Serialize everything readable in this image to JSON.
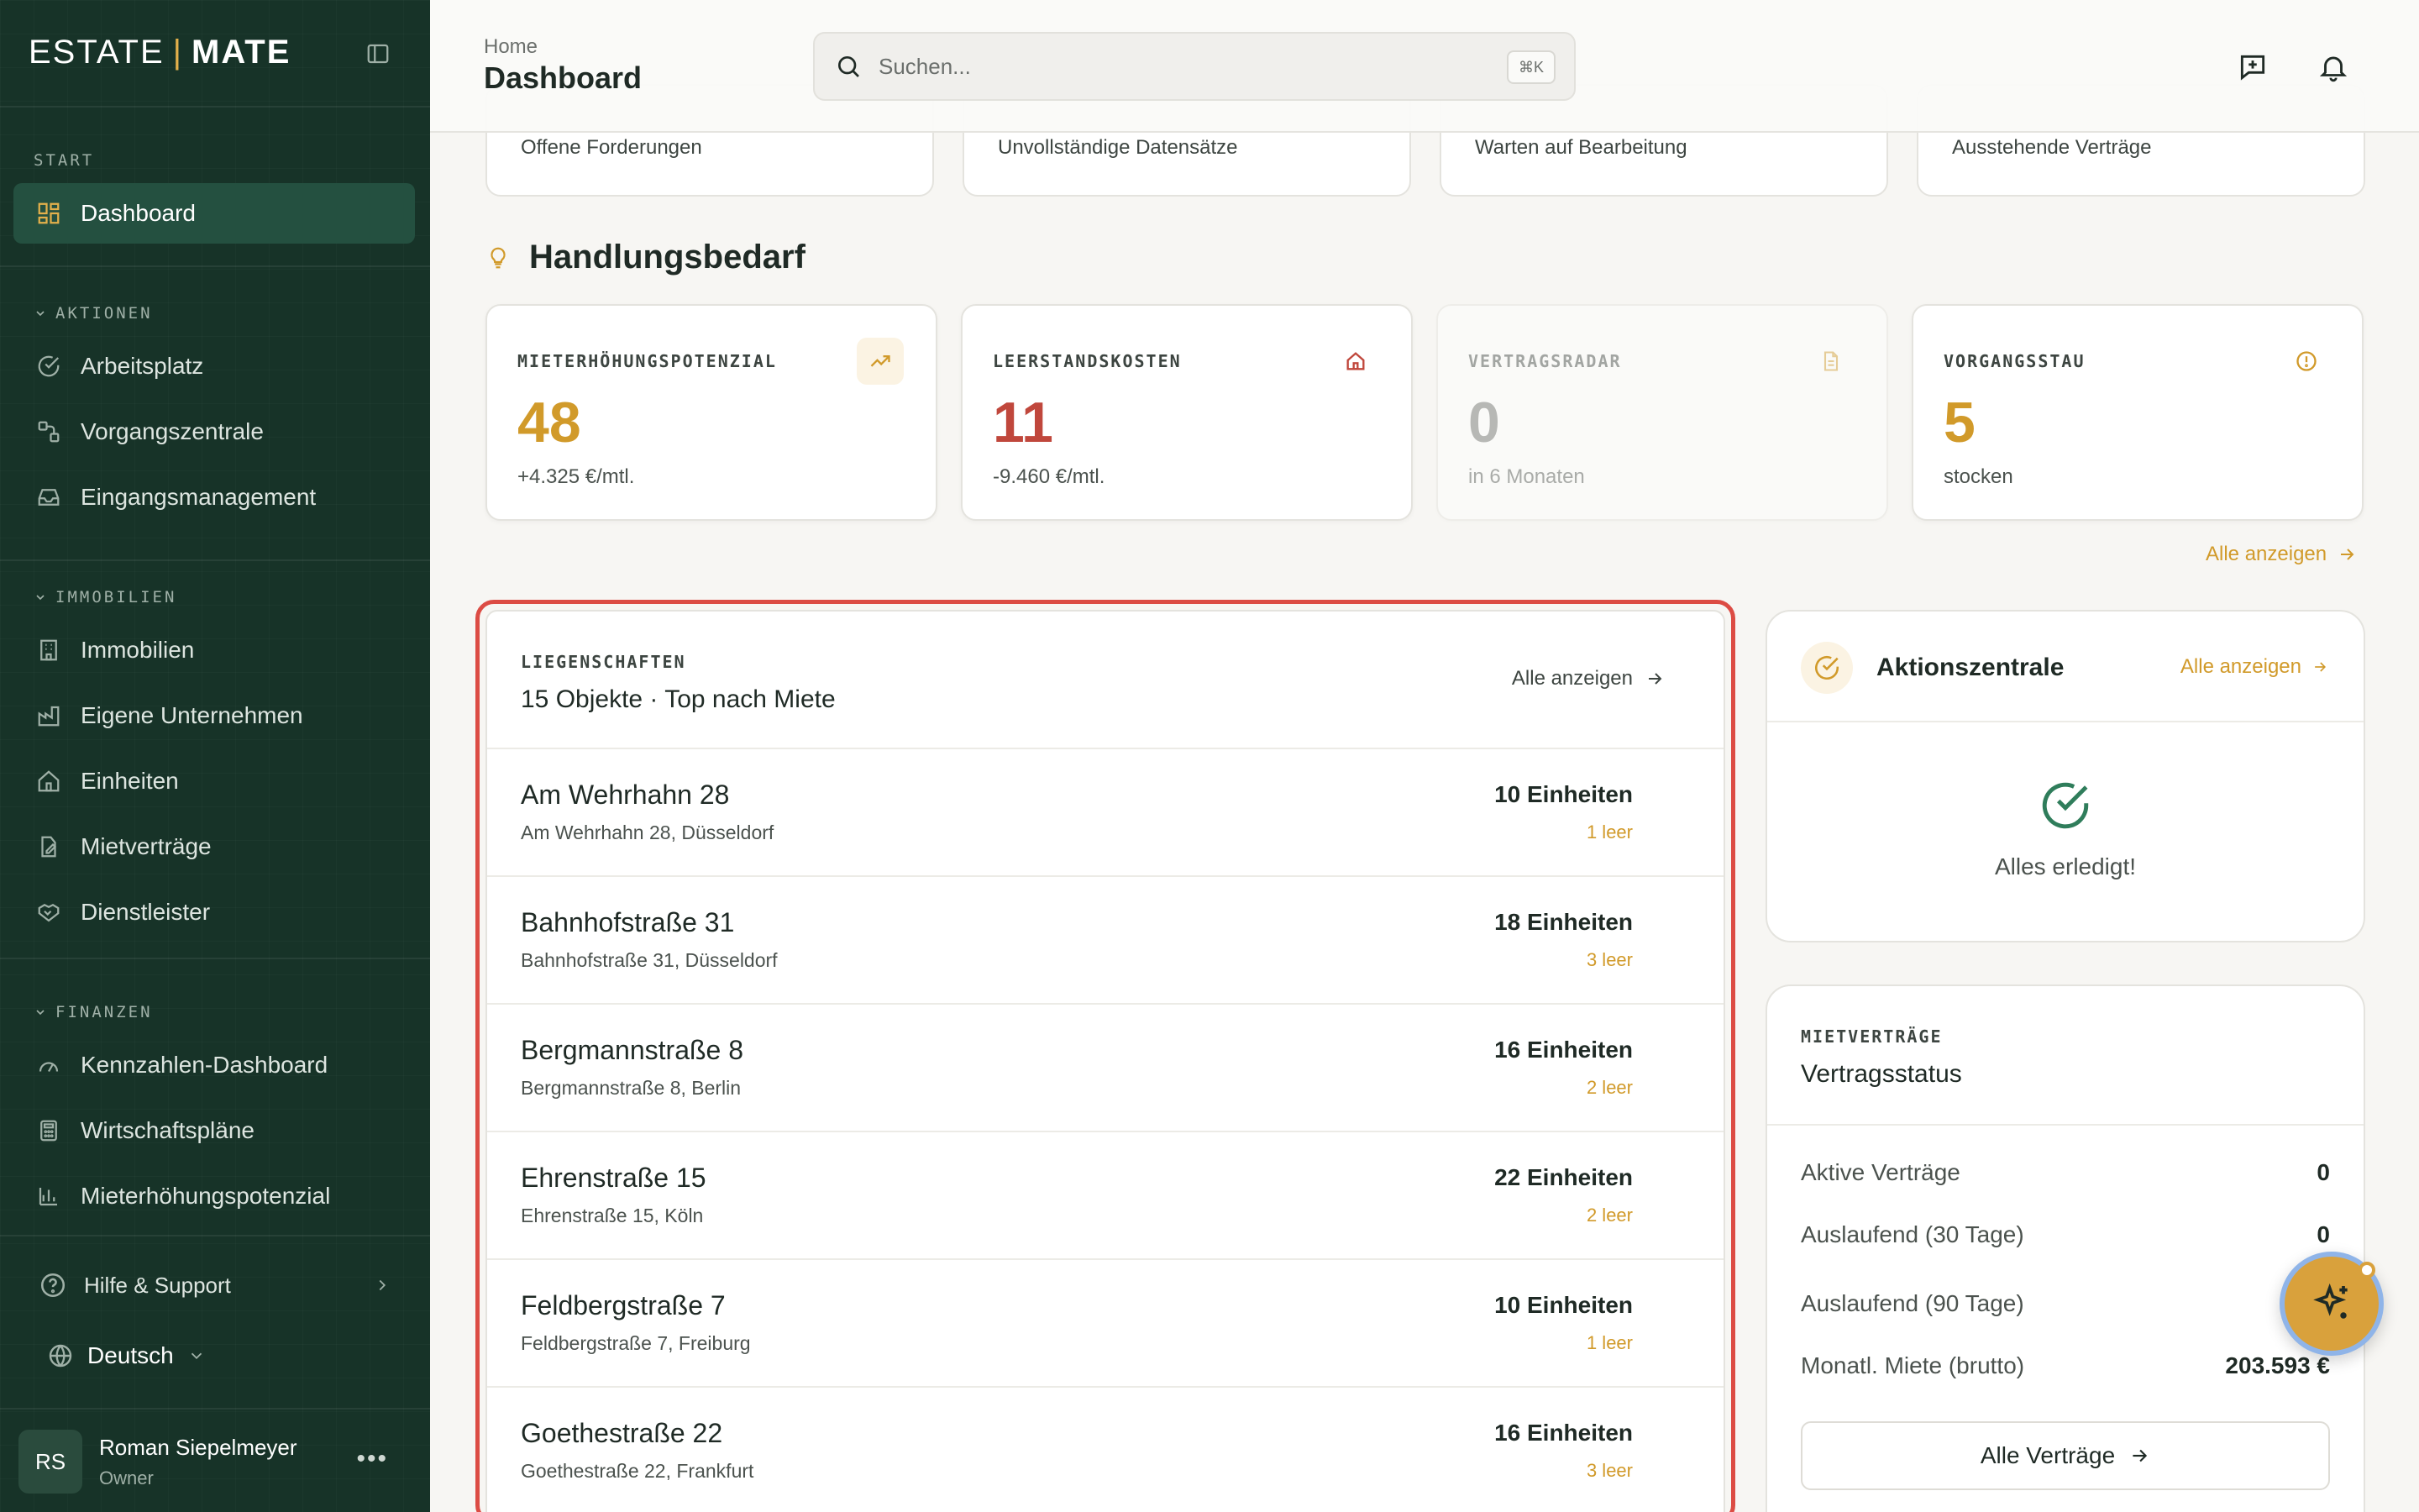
{
  "brand": {
    "part1": "ESTATE",
    "separator": "|",
    "part2": "MATE"
  },
  "colors": {
    "sidebar_bg": "#173328",
    "accent_gold": "#d19a2a",
    "danger_red": "#c0473c",
    "highlight_border": "#dc4c44",
    "success_green": "#2f7d5b"
  },
  "sidebar": {
    "start_title": "START",
    "dashboard": "Dashboard",
    "aktionen_title": "AKTIONEN",
    "aktionen": [
      "Arbeitsplatz",
      "Vorgangszentrale",
      "Eingangsmanagement"
    ],
    "immobilien_title": "IMMOBILIEN",
    "immobilien": [
      "Immobilien",
      "Eigene Unternehmen",
      "Einheiten",
      "Mietverträge",
      "Dienstleister"
    ],
    "finanzen_title": "FINANZEN",
    "finanzen": [
      "Kennzahlen-Dashboard",
      "Wirtschaftspläne",
      "Mieterhöhungspotenzial"
    ],
    "help": "Hilfe & Support",
    "language": "Deutsch",
    "user": {
      "initials": "RS",
      "name": "Roman Siepelmeyer",
      "role": "Owner"
    }
  },
  "header": {
    "breadcrumb": "Home",
    "title": "Dashboard",
    "search_placeholder": "Suchen...",
    "search_shortcut": "⌘K"
  },
  "top_stats": [
    "Offene Forderungen",
    "Unvollständige Datensätze",
    "Warten auf Bearbeitung",
    "Ausstehende Verträge"
  ],
  "handlungsbedarf": {
    "title": "Handlungsbedarf",
    "cards": [
      {
        "label": "MIETERHÖHUNGSPOTENZIAL",
        "value": "48",
        "sub": "+4.325 €/mtl.",
        "color": "#d19a2a",
        "icon": "trending-up-icon"
      },
      {
        "label": "LEERSTANDSKOSTEN",
        "value": "11",
        "sub": "-9.460 €/mtl.",
        "color": "#c0473c",
        "icon": "home-icon"
      },
      {
        "label": "VERTRAGSRADAR",
        "value": "0",
        "sub": "in 6 Monaten",
        "color": "#6b6f6c",
        "icon": "document-icon"
      },
      {
        "label": "VORGANGSSTAU",
        "value": "5",
        "sub": "stocken",
        "color": "#d19a2a",
        "icon": "alert-circle-icon"
      }
    ],
    "all_link": "Alle anzeigen"
  },
  "liegenschaften": {
    "eyebrow": "LIEGENSCHAFTEN",
    "subtitle": "15 Objekte · Top nach Miete",
    "all_link": "Alle anzeigen",
    "rows": [
      {
        "name": "Am Wehrhahn 28",
        "address": "Am Wehrhahn 28, Düsseldorf",
        "units": "10 Einheiten",
        "vacant": "1 leer"
      },
      {
        "name": "Bahnhofstraße 31",
        "address": "Bahnhofstraße 31, Düsseldorf",
        "units": "18 Einheiten",
        "vacant": "3 leer"
      },
      {
        "name": "Bergmannstraße 8",
        "address": "Bergmannstraße 8, Berlin",
        "units": "16 Einheiten",
        "vacant": "2 leer"
      },
      {
        "name": "Ehrenstraße 15",
        "address": "Ehrenstraße 15, Köln",
        "units": "22 Einheiten",
        "vacant": "2 leer"
      },
      {
        "name": "Feldbergstraße 7",
        "address": "Feldbergstraße 7, Freiburg",
        "units": "10 Einheiten",
        "vacant": "1 leer"
      },
      {
        "name": "Goethestraße 22",
        "address": "Goethestraße 22, Frankfurt",
        "units": "16 Einheiten",
        "vacant": "3 leer"
      }
    ]
  },
  "aktionszentrale": {
    "title": "Aktionszentrale",
    "all_link": "Alle anzeigen",
    "done_text": "Alles erledigt!"
  },
  "mietvertraege": {
    "eyebrow": "MIETVERTRÄGE",
    "title": "Vertragsstatus",
    "rows": [
      {
        "label": "Aktive Verträge",
        "value": "0"
      },
      {
        "label": "Auslaufend (30 Tage)",
        "value": "0"
      },
      {
        "label": "Auslaufend (90 Tage)",
        "value": ""
      },
      {
        "label": "Monatl. Miete (brutto)",
        "value": "203.593 €"
      }
    ],
    "button": "Alle Verträge"
  }
}
